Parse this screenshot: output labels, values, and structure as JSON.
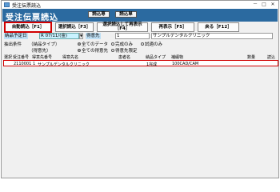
{
  "window": {
    "title": "受注伝票読込",
    "controls": [
      "－",
      "□",
      "✕"
    ]
  },
  "header": {
    "title": "受注伝票読込",
    "mode_buttons": [
      "読込専",
      "読込単"
    ]
  },
  "function_keys": [
    {
      "label": "自動読込［F1］",
      "active": true
    },
    {
      "label": "選択読込［F3］",
      "active": false
    },
    {
      "label": "選択読込して再表示［F4］",
      "active": false
    },
    {
      "label": "再表示［F5］",
      "active": false
    },
    {
      "label": "戻る［F12］",
      "active": false
    }
  ],
  "filters": {
    "delivery_date_label": "納品予定日",
    "delivery_date_value": "R 07/11/(金)",
    "customer_label": "得意先",
    "customer_code": "1",
    "customer_name": "サンプルデンタルクリニック",
    "conditions_label": "抽出条件",
    "delivery_type_label": "（納品タイプ）",
    "delivery_type_options": [
      {
        "label": "全てのデータ",
        "selected": true
      },
      {
        "label": "完成のみ",
        "selected": false
      },
      {
        "label": "試適のみ",
        "selected": false
      }
    ],
    "customer_filter_label": "（得意先）",
    "customer_filter_options": [
      {
        "label": "全ての得意先",
        "selected": true
      },
      {
        "label": "得意先限定",
        "selected": false
      }
    ]
  },
  "grid": {
    "columns": [
      "選択",
      "受注番号",
      "得意先番号",
      "得意先名",
      "患者名",
      "納品タイプ",
      "補綴物",
      "数量",
      "読込"
    ],
    "rows": [
      {
        "select": "",
        "order_no": "2110001",
        "customer_no": "1",
        "customer_name": "サンプルデンタルクリニック",
        "patient": "",
        "delivery_type": "1完成",
        "prosthesis": "100CAD/CAM",
        "qty": "",
        "loaded": ""
      }
    ]
  }
}
